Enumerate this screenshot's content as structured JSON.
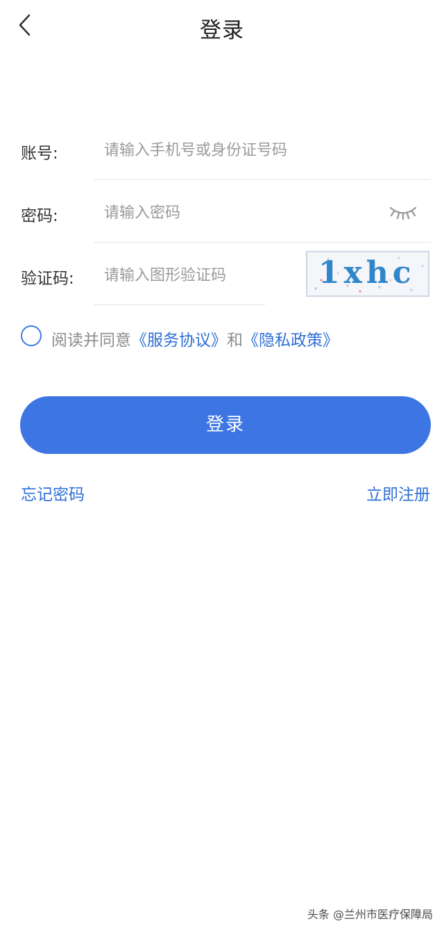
{
  "header": {
    "title": "登录",
    "back_icon": "chevron-left-icon"
  },
  "form": {
    "account": {
      "label": "账号:",
      "placeholder": "请输入手机号或身份证号码"
    },
    "password": {
      "label": "密码:",
      "placeholder": "请输入密码",
      "toggle_icon": "eye-closed-icon"
    },
    "captcha": {
      "label": "验证码:",
      "placeholder": "请输入图形验证码",
      "image_text": "1xhc"
    }
  },
  "agreement": {
    "prefix": "阅读并同意",
    "service_link": "《服务协议》",
    "middle": "和",
    "privacy_link": "《隐私政策》",
    "checked": false
  },
  "actions": {
    "login_label": "登录",
    "forgot_label": "忘记密码",
    "register_label": "立即注册"
  },
  "watermark": "头条 @兰州市医疗保障局",
  "colors": {
    "primary": "#3d75e3",
    "link": "#2e6fd6",
    "placeholder": "#9a9a9a",
    "divider": "#e3e3e3"
  }
}
